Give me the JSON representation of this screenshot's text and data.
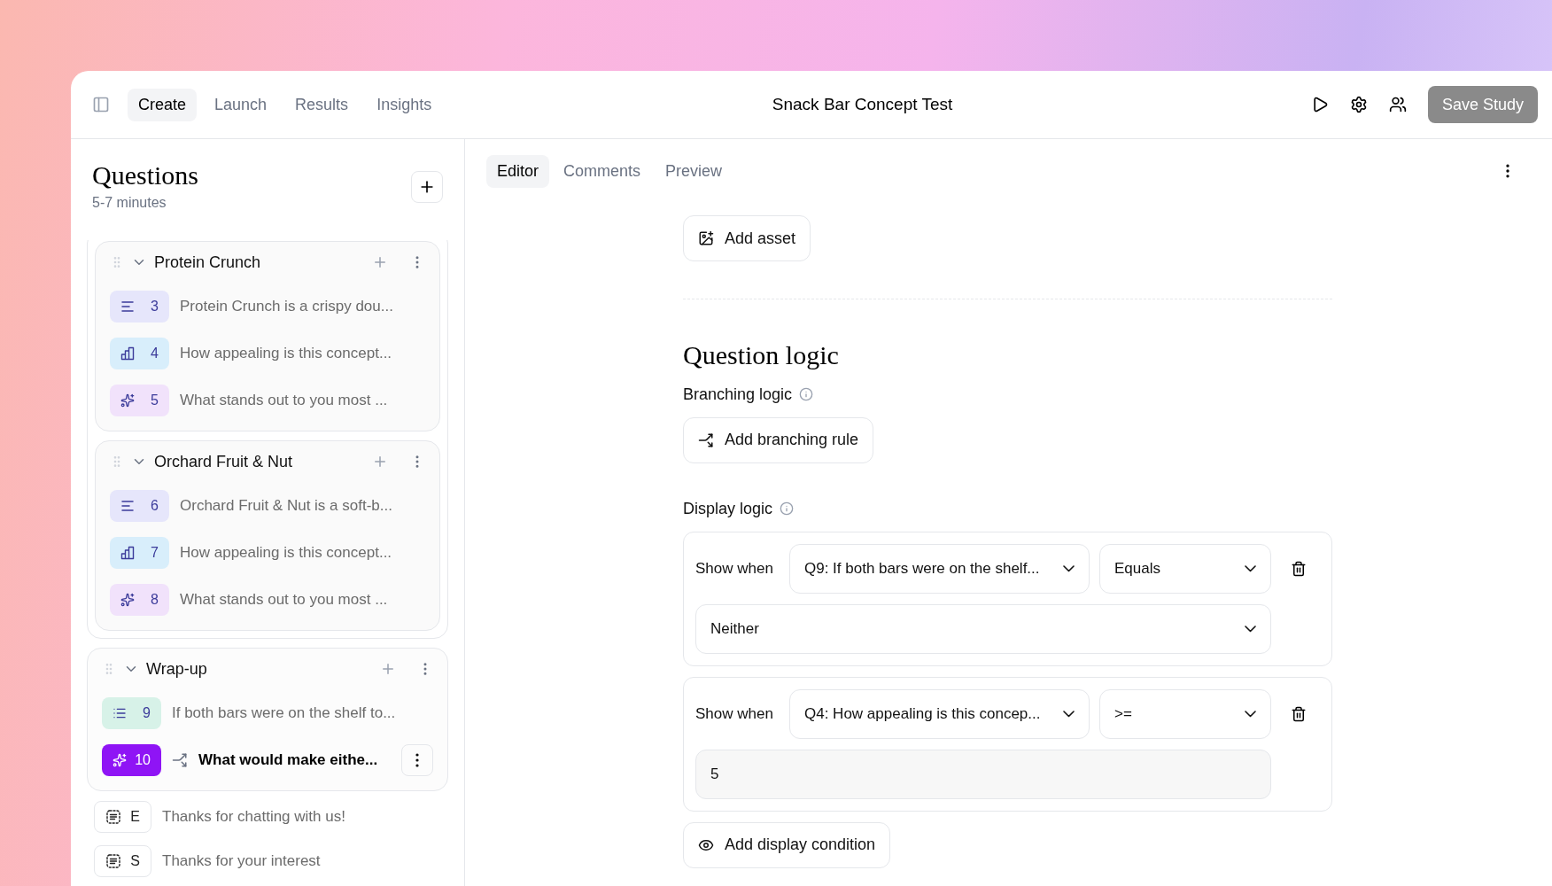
{
  "header": {
    "tabs": [
      {
        "label": "Create",
        "selected": true
      },
      {
        "label": "Launch",
        "selected": false
      },
      {
        "label": "Results",
        "selected": false
      },
      {
        "label": "Insights",
        "selected": false
      }
    ],
    "title": "Snack Bar Concept Test",
    "save_button": "Save Study"
  },
  "sidebar": {
    "title": "Questions",
    "duration": "5-7 minutes",
    "sections": [
      {
        "title": "Protein Crunch",
        "nested": true,
        "items": [
          {
            "kind": "text",
            "number": "3",
            "text": "Protein Crunch is a crispy dou...",
            "selected": false,
            "branching": false
          },
          {
            "kind": "rating",
            "number": "4",
            "text": "How appealing is this concept...",
            "selected": false,
            "branching": false
          },
          {
            "kind": "ai",
            "number": "5",
            "text": "What stands out to you most ...",
            "selected": false,
            "branching": false
          }
        ]
      },
      {
        "title": "Orchard Fruit & Nut",
        "nested": true,
        "items": [
          {
            "kind": "text",
            "number": "6",
            "text": "Orchard Fruit & Nut is a soft-b...",
            "selected": false,
            "branching": false
          },
          {
            "kind": "rating",
            "number": "7",
            "text": "How appealing is this concept...",
            "selected": false,
            "branching": false
          },
          {
            "kind": "ai",
            "number": "8",
            "text": "What stands out to you most ...",
            "selected": false,
            "branching": false
          }
        ]
      },
      {
        "title": "Wrap-up",
        "nested": false,
        "items": [
          {
            "kind": "choice",
            "number": "9",
            "text": "If both bars were on the shelf to...",
            "selected": false,
            "branching": false
          },
          {
            "kind": "ai",
            "number": "10",
            "text": "What would make eithe...",
            "selected": true,
            "branching": true
          }
        ]
      }
    ],
    "endings": [
      {
        "letter": "E",
        "text": "Thanks for chatting with us!"
      },
      {
        "letter": "S",
        "text": "Thanks for your interest"
      }
    ]
  },
  "editor": {
    "tabs": [
      {
        "label": "Editor",
        "selected": true
      },
      {
        "label": "Comments",
        "selected": false
      },
      {
        "label": "Preview",
        "selected": false
      }
    ],
    "add_asset": "Add asset",
    "logic_title": "Question logic",
    "branching_label": "Branching logic",
    "add_branching": "Add branching rule",
    "display_label": "Display logic",
    "conditions": [
      {
        "label": "Show when",
        "question": "Q9: If both bars were on the shelf...",
        "operator": "Equals",
        "value": {
          "kind": "select",
          "text": "Neither"
        }
      },
      {
        "label": "Show when",
        "question": "Q4: How appealing is this concep...",
        "operator": ">=",
        "value": {
          "kind": "input",
          "text": "5"
        }
      }
    ],
    "add_condition": "Add display condition"
  }
}
